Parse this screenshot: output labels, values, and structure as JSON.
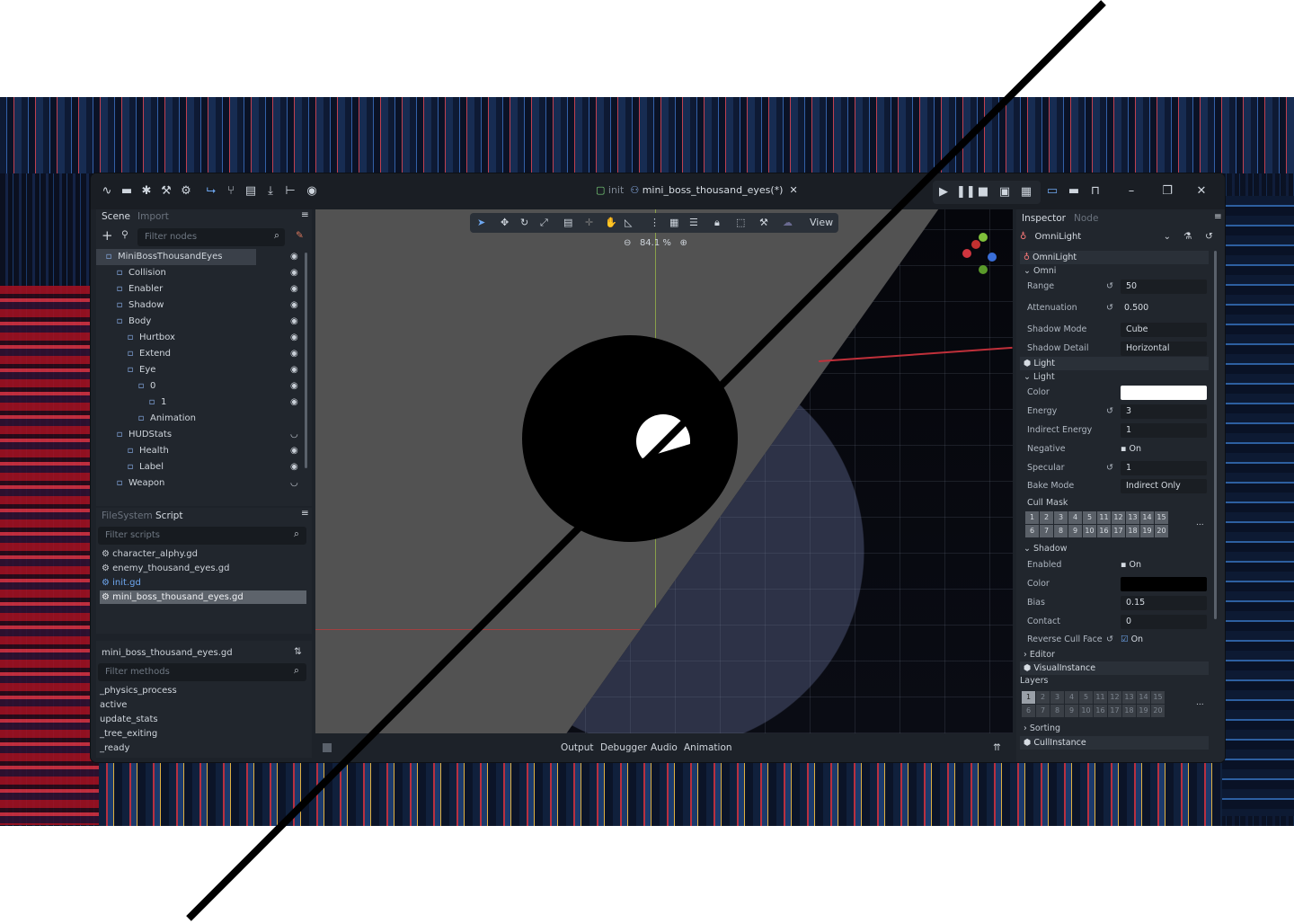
{
  "titlebar": {
    "tab_prefix": "init",
    "tab_name": "mini_boss_thousand_eyes(*)",
    "tab_close": "✕"
  },
  "scene_dock": {
    "tabs": [
      "Scene",
      "Import"
    ],
    "filter_placeholder": "Filter nodes",
    "nodes": [
      {
        "label": "MiniBossThousandEyes",
        "depth": 0,
        "icon": "person-icon"
      },
      {
        "label": "Collision",
        "depth": 1,
        "icon": "square-icon"
      },
      {
        "label": "Enabler",
        "depth": 1,
        "icon": "target-icon"
      },
      {
        "label": "Shadow",
        "depth": 1,
        "icon": "face-icon"
      },
      {
        "label": "Body",
        "depth": 1,
        "icon": "face-icon"
      },
      {
        "label": "Hurtbox",
        "depth": 2,
        "icon": "crosshair-icon"
      },
      {
        "label": "Extend",
        "depth": 2,
        "icon": "cloud-icon"
      },
      {
        "label": "Eye",
        "depth": 2,
        "icon": "move-icon"
      },
      {
        "label": "0",
        "depth": 3,
        "icon": "face-icon"
      },
      {
        "label": "1",
        "depth": 4,
        "icon": "face-icon"
      },
      {
        "label": "Animation",
        "depth": 3,
        "icon": "film-icon"
      },
      {
        "label": "HUDStats",
        "depth": 1,
        "icon": "panel-icon"
      },
      {
        "label": "Health",
        "depth": 2,
        "icon": "bar-icon"
      },
      {
        "label": "Label",
        "depth": 2,
        "icon": "tag-icon"
      },
      {
        "label": "Weapon",
        "depth": 1,
        "icon": "circle-icon"
      }
    ]
  },
  "script_dock": {
    "tabs": [
      "FileSystem",
      "Script"
    ],
    "filter_placeholder": "Filter scripts",
    "scripts": [
      "character_alphy.gd",
      "enemy_thousand_eyes.gd",
      "init.gd",
      "mini_boss_thousand_eyes.gd"
    ],
    "current_file": "mini_boss_thousand_eyes.gd",
    "methods_placeholder": "Filter methods",
    "methods": [
      "_physics_process",
      "active",
      "update_stats",
      "_tree_exiting",
      "_ready"
    ]
  },
  "viewport": {
    "view_label": "View",
    "zoom": "84.1 %"
  },
  "bottom_tabs": [
    "Output",
    "Debugger",
    "Audio",
    "Animation"
  ],
  "inspector": {
    "tabs": [
      "Inspector",
      "Node"
    ],
    "object": "OmniLight",
    "sections": {
      "omnilight": "OmniLight",
      "omni": "Omni",
      "light_cat": "Light",
      "light": "Light",
      "shadow": "Shadow",
      "editor": "Editor",
      "visual_instance": "VisualInstance",
      "layers": "Layers",
      "sorting": "Sorting",
      "cull_instance": "CullInstance"
    },
    "props": {
      "range": {
        "label": "Range",
        "value": "50"
      },
      "attenuation": {
        "label": "Attenuation",
        "value": "0.500"
      },
      "shadow_mode": {
        "label": "Shadow Mode",
        "value": "Cube"
      },
      "shadow_detail": {
        "label": "Shadow Detail",
        "value": "Horizontal"
      },
      "color": {
        "label": "Color"
      },
      "energy": {
        "label": "Energy",
        "value": "3"
      },
      "indirect_energy": {
        "label": "Indirect Energy",
        "value": "1"
      },
      "negative": {
        "label": "Negative",
        "value": "On"
      },
      "specular": {
        "label": "Specular",
        "value": "1"
      },
      "bake_mode": {
        "label": "Bake Mode",
        "value": "Indirect Only"
      },
      "cull_mask": {
        "label": "Cull Mask"
      },
      "shadow_enabled": {
        "label": "Enabled",
        "value": "On"
      },
      "shadow_color": {
        "label": "Color"
      },
      "bias": {
        "label": "Bias",
        "value": "0.15"
      },
      "contact": {
        "label": "Contact",
        "value": "0"
      },
      "reverse_cull": {
        "label": "Reverse Cull Face",
        "value": "On"
      }
    },
    "bits_row1": [
      "1",
      "2",
      "3",
      "4",
      "5",
      "11",
      "12",
      "13",
      "14",
      "15"
    ],
    "bits_row2": [
      "6",
      "7",
      "8",
      "9",
      "10",
      "16",
      "17",
      "18",
      "19",
      "20"
    ],
    "more": "..."
  },
  "colors": {
    "accent": "#6ea7f0",
    "light_color": "#ffffff",
    "shadow_color": "#000000"
  }
}
